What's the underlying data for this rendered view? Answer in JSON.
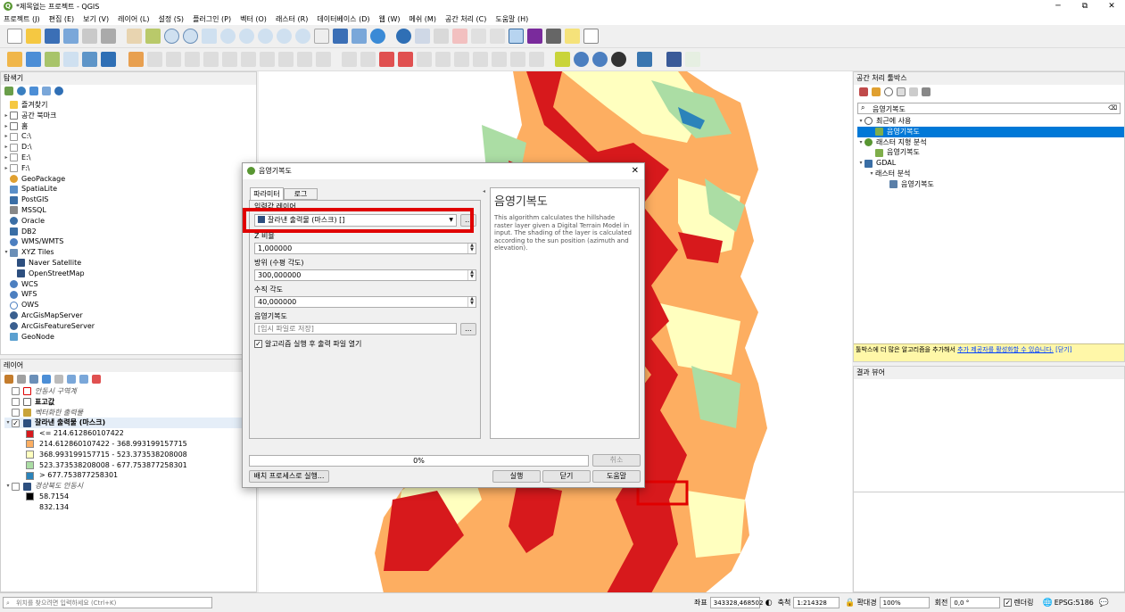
{
  "window": {
    "title": "*제목없는 프로젝트 - QGIS",
    "min": "─",
    "max": "⧉",
    "close": "✕"
  },
  "menu": [
    "프로젝트 (J)",
    "편집 (E)",
    "보기 (V)",
    "레이어 (L)",
    "설정 (S)",
    "플러그인 (P)",
    "벡터 (O)",
    "래스터 (R)",
    "데이터베이스 (D)",
    "웹 (W)",
    "메쉬 (M)",
    "공간 처리 (C)",
    "도움말 (H)"
  ],
  "browser": {
    "title": "탐색기",
    "items": [
      "즐겨찾기",
      "공간 북마크",
      "홈",
      "C:\\",
      "D:\\",
      "E:\\",
      "F:\\",
      "GeoPackage",
      "SpatiaLite",
      "PostGIS",
      "MSSQL",
      "Oracle",
      "DB2",
      "WMS/WMTS",
      "XYZ Tiles",
      "Naver Satellite",
      "OpenStreetMap",
      "WCS",
      "WFS",
      "OWS",
      "ArcGisMapServer",
      "ArcGisFeatureServer",
      "GeoNode"
    ]
  },
  "layers": {
    "title": "레이어",
    "items": [
      {
        "label": "안동시 구역계",
        "italic": true,
        "checked": false
      },
      {
        "label": "표고값",
        "bold": true,
        "checked": false
      },
      {
        "label": "벡터화한 출력물",
        "italic": true,
        "checked": false
      },
      {
        "label": "잘라낸 출력물 (마스크)",
        "bold": true,
        "checked": true
      }
    ],
    "legend": [
      {
        "color": "#d7191c",
        "label": "<= 214.612860107422"
      },
      {
        "color": "#fdae61",
        "label": "214.612860107422 - 368.993199157715"
      },
      {
        "color": "#ffffbf",
        "label": "368.993199157715 - 523.373538208008"
      },
      {
        "color": "#abdda4",
        "label": "523.373538208008 - 677.753877258301"
      },
      {
        "color": "#2b83ba",
        "label": "> 677.753877258301"
      }
    ],
    "extra_layer": "경상북도 안동시",
    "extra_legend": [
      {
        "color": "#000000",
        "label": "58.7154"
      },
      {
        "color": "#ffffff",
        "label": "832.134"
      }
    ]
  },
  "dialog": {
    "title": "음영기복도",
    "tabs": [
      "파라미터",
      "로그"
    ],
    "input_layer_label": "입력값 레이어",
    "input_layer_value": "잘라낸 출력물 (마스크) []",
    "z_label": "Z 비율",
    "z_value": "1,000000",
    "azimuth_label": "방위 (수평 각도)",
    "azimuth_value": "300,000000",
    "altitude_label": "수직 각도",
    "altitude_value": "40,000000",
    "output_label": "음영기복도",
    "output_placeholder": "[임시 파일로 저장]",
    "open_output_label": "알고리즘 실행 후 출력 파일 열기",
    "help_title": "음영기복도",
    "help_text": "This algorithm calculates the hillshade raster layer given a Digital Terrain Model in input. The shading of the layer is calculated according to the sun position (azimuth and elevation).",
    "progress": "0%",
    "progress_value": 0,
    "cancel": "취소",
    "batch": "배치 프로세스로 실행...",
    "run": "실행",
    "close": "닫기",
    "help": "도움말"
  },
  "toolbox": {
    "title": "공간 처리 툴박스",
    "search": "음영기복도",
    "recent": "최근에 사용",
    "recent_item": "음영기복도",
    "raster_terrain": "래스터 지형 분석",
    "raster_terrain_item": "음영기복도",
    "gdal": "GDAL",
    "raster_analysis": "래스터 분석",
    "gdal_item": "음영기복도",
    "notice_text": "툴박스에 더 많은 알고리즘을 추가해서 ",
    "notice_link": "추가 제공자를 활성화할 수 있습니다.",
    "notice_close": "[닫기]"
  },
  "results": {
    "title": "결과 뷰어"
  },
  "status": {
    "locator_placeholder": "위치를 찾으려면 입력하세요 (Ctrl+K)",
    "coord_label": "좌표",
    "coord_value": "343328,468502",
    "scale_label": "축척",
    "scale_value": "1:214328",
    "magnifier_label": "확대경",
    "magnifier_value": "100%",
    "rotation_label": "회전",
    "rotation_value": "0,0 °",
    "render_label": "렌더링",
    "crs": "EPSG:5186"
  }
}
